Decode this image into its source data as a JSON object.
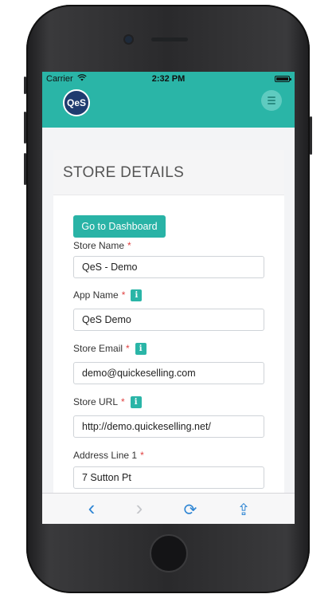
{
  "status_bar": {
    "carrier": "Carrier",
    "wifi_icon": "wifi-icon",
    "time": "2:32 PM",
    "battery_icon": "battery-icon"
  },
  "header": {
    "logo_text": "QeS",
    "menu_icon": "hamburger-menu-icon",
    "accent_color": "#2ab5a7",
    "logo_color": "#1f3b6f"
  },
  "page": {
    "title": "STORE DETAILS",
    "dashboard_button": "Go to Dashboard"
  },
  "form": {
    "store_name": {
      "label": "Store Name",
      "required": "*",
      "value": "QeS - Demo"
    },
    "app_name": {
      "label": "App Name",
      "required": "*",
      "info": "i",
      "value": "QeS Demo"
    },
    "store_email": {
      "label": "Store Email",
      "required": "*",
      "info": "i",
      "value": "demo@quickeselling.com"
    },
    "store_url": {
      "label": "Store URL",
      "required": "*",
      "info": "i",
      "value": "http://demo.quickeselling.net/"
    },
    "address_line_1": {
      "label": "Address Line 1",
      "required": "*",
      "value": "7 Sutton Pt"
    }
  },
  "browser_toolbar": {
    "back": "‹",
    "forward": "›",
    "reload": "⟳",
    "share": "⇪"
  }
}
